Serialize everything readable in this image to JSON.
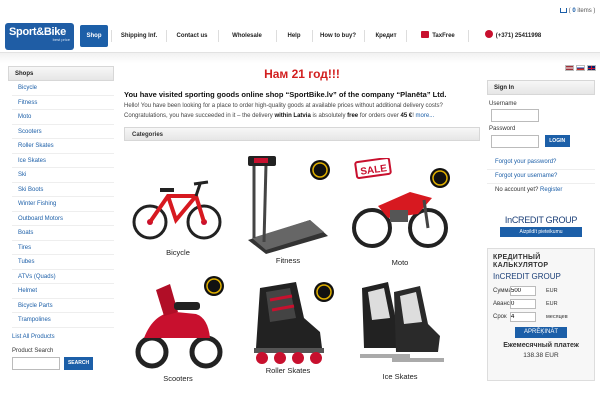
{
  "topbar": {
    "cart_count": "0",
    "cart_label": "items"
  },
  "logo": {
    "title": "Sport&Bike",
    "subtitle": "best price"
  },
  "nav": {
    "items": [
      {
        "label": "Shop"
      },
      {
        "label": "Shipping Inf."
      },
      {
        "label": "Contact us"
      },
      {
        "label": "Wholesale"
      },
      {
        "label": "Help"
      },
      {
        "label": "How to buy?"
      },
      {
        "label": "Кредит"
      },
      {
        "label": "TaxFree"
      },
      {
        "label": "(+371) 25411998"
      }
    ]
  },
  "sidebar": {
    "title": "Shops",
    "items": [
      "Bicycle",
      "Fitness",
      "Moto",
      "Scooters",
      "Roller Skates",
      "Ice Skates",
      "Ski",
      "Ski Boots",
      "Winter Fishing",
      "Outboard Motors",
      "Boats",
      "Tires",
      "Tubes",
      "ATVs (Quads)",
      "Helmet",
      "Bicycle Parts",
      "Trampolines"
    ],
    "all_products": "List All Products",
    "search_label": "Product Search",
    "search_value": "",
    "search_button": "SEARCH"
  },
  "main": {
    "promo": "Нам 21 год!!!",
    "intro_title": "You have visited sporting goods online shop “SportBike.lv” of the company “Planēta” Ltd.",
    "intro_text_1": "Hello! You have been looking for a place to order high-quality goods at available prices without additional delivery costs? Congratulations, you have succeeded in it – the delivery ",
    "intro_bold_1": "within Latvia",
    "intro_text_2": " is absolutely ",
    "intro_bold_2": "free",
    "intro_text_3": " for orders over ",
    "intro_bold_3": "45 €",
    "intro_text_4": "! ",
    "intro_more": "more...",
    "categories_title": "Categories",
    "products": [
      {
        "label": "Bicycle"
      },
      {
        "label": "Fitness"
      },
      {
        "label": "Moto"
      },
      {
        "label": "Scooters"
      },
      {
        "label": "Roller Skates"
      },
      {
        "label": "Ice Skates"
      }
    ],
    "sale_badge": "SALE"
  },
  "login": {
    "title": "Sign In",
    "username_label": "Username",
    "username_value": "",
    "password_label": "Password",
    "password_value": "",
    "button": "LOGIN",
    "forgot_password": "Forgot your password?",
    "forgot_username": "Forgot your username?",
    "no_account": "No account yet?",
    "register": "Register"
  },
  "incredit": {
    "brand": "InCREDIT GROUP",
    "apply": "Aizpildīt pieteikumu"
  },
  "calculator": {
    "title_line1": "КРЕДИТНЫЙ",
    "title_line2": "КАЛЬКУЛЯТОР",
    "brand": "InCREDIT GROUP",
    "sum_label": "Сумма:",
    "sum_value": "500",
    "sum_unit": "EUR",
    "advance_label": "Аванс:",
    "advance_value": "0",
    "advance_unit": "EUR",
    "term_label": "Срок",
    "term_value": "4",
    "term_unit": "месяцев",
    "button": "APRĒĶINĀT",
    "monthly_label": "Ежемесячный платеж",
    "monthly_value": "138.38 EUR"
  },
  "colors": {
    "accent": "#1c5fa8",
    "promo": "#d21f1f",
    "brand_dark": "#1b3f78"
  }
}
